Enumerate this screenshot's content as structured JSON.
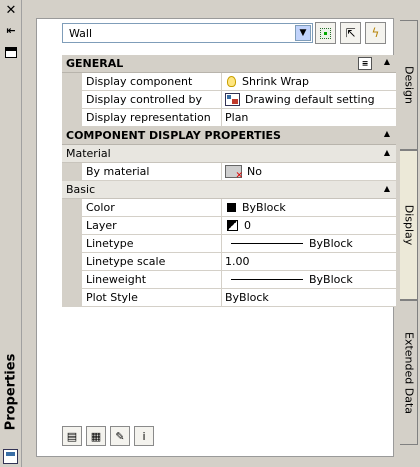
{
  "strip": {
    "title": "Properties",
    "close_icon": "close-icon",
    "autohide_icon": "autohide-icon",
    "menu_icon": "properties-menu-icon"
  },
  "selector": {
    "value": "Wall"
  },
  "tabs": [
    "Design",
    "Display",
    "Extended Data"
  ],
  "grid": {
    "general": {
      "label": "GENERAL",
      "rows": [
        {
          "name": "Display component",
          "value": "Shrink Wrap",
          "icon": "bulb-icon"
        },
        {
          "name": "Display controlled by",
          "value": "Drawing default setting",
          "icon": "drawing-default-icon"
        },
        {
          "name": "Display representation",
          "value": "Plan"
        }
      ]
    },
    "component": {
      "label": "COMPONENT DISPLAY PROPERTIES",
      "material": {
        "label": "Material",
        "rows": [
          {
            "name": "By material",
            "value": "No",
            "icon": "material-icon"
          }
        ]
      },
      "basic": {
        "label": "Basic",
        "rows": [
          {
            "name": "Color",
            "value": "ByBlock",
            "icon": "color-swatch-icon"
          },
          {
            "name": "Layer",
            "value": "0",
            "icon": "layer-icon"
          },
          {
            "name": "Linetype",
            "value": "ByBlock"
          },
          {
            "name": "Linetype scale",
            "value": "1.00"
          },
          {
            "name": "Lineweight",
            "value": "ByBlock"
          },
          {
            "name": "Plot Style",
            "value": "ByBlock"
          }
        ]
      }
    }
  },
  "colors": {
    "panel_bg": "#d4d0c8",
    "selector_border": "#7f9db9",
    "grid_bg": "#ffffff"
  }
}
